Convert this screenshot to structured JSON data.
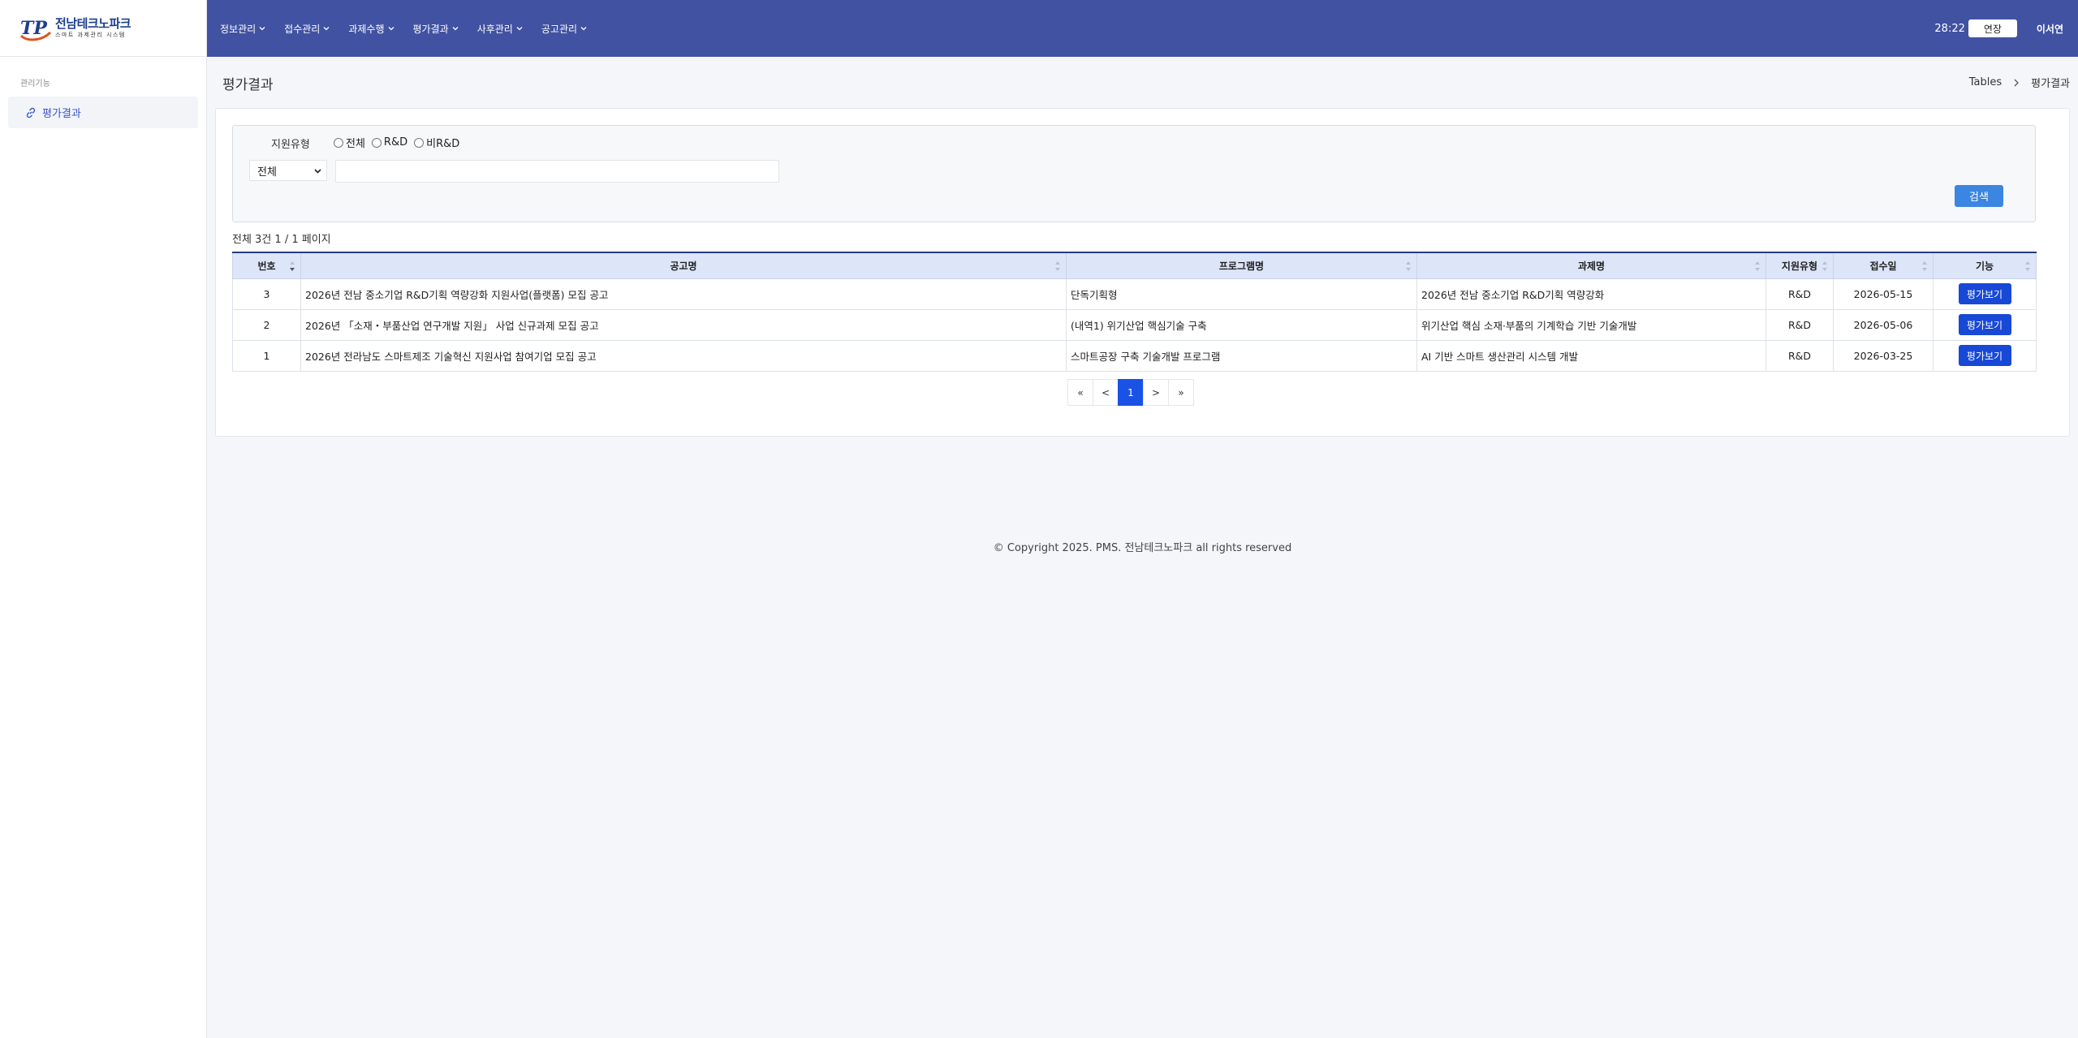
{
  "brand": {
    "title": "전남테크노파크",
    "subtitle": "스마트 과제관리 시스템",
    "logo_letters": "TP"
  },
  "sidebar": {
    "section": "관리기능",
    "items": [
      {
        "label": "평가결과",
        "icon": "link-icon"
      }
    ]
  },
  "nav": {
    "menus": [
      "정보관리",
      "접수관리",
      "과제수행",
      "평가결과",
      "사후관리",
      "공고관리"
    ],
    "timer": "28:22",
    "extend_label": "연장",
    "user": "이서연"
  },
  "header": {
    "title": "평가결과",
    "breadcrumb": [
      "Tables",
      "평가결과"
    ]
  },
  "search": {
    "type_label": "지원유형",
    "radio_options": [
      "전체",
      "R&D",
      "비R&D"
    ],
    "select_value": "전체",
    "input_value": "",
    "button_label": "검색"
  },
  "summary": "전체 3건 1 / 1 페이지",
  "table": {
    "columns": [
      "번호",
      "공고명",
      "프로그램명",
      "과제명",
      "지원유형",
      "접수일",
      "기능"
    ],
    "rows": [
      {
        "no": "3",
        "notice": "2026년 전남 중소기업 R&D기획 역량강화 지원사업(플랫폼) 모집 공고",
        "program": "단독기획형",
        "project": "2026년 전남 중소기업 R&D기획 역량강화",
        "type": "R&D",
        "date": "2026-05-15",
        "action": "평가보기"
      },
      {
        "no": "2",
        "notice": "2026년 「소재・부품산업 연구개발 지원」 사업 신규과제 모집 공고",
        "program": "(내역1) 위기산업 핵심기술 구축",
        "project": "위기산업 핵심 소재·부품의 기계학습 기반 기술개발",
        "type": "R&D",
        "date": "2026-05-06",
        "action": "평가보기"
      },
      {
        "no": "1",
        "notice": "2026년 전라남도 스마트제조 기술혁신 지원사업 참여기업 모집 공고",
        "program": "스마트공장 구축 기술개발 프로그램",
        "project": "AI 기반 스마트 생산관리 시스템 개발",
        "type": "R&D",
        "date": "2026-03-25",
        "action": "평가보기"
      }
    ]
  },
  "pagination": [
    "«",
    "<",
    "1",
    ">",
    "»"
  ],
  "footer": "© Copyright 2025. PMS. 전남테크노파크 all rights reserved",
  "colors": {
    "nav": "#4152a2",
    "accent": "#1848d6",
    "header_row": "#dde5f9"
  }
}
